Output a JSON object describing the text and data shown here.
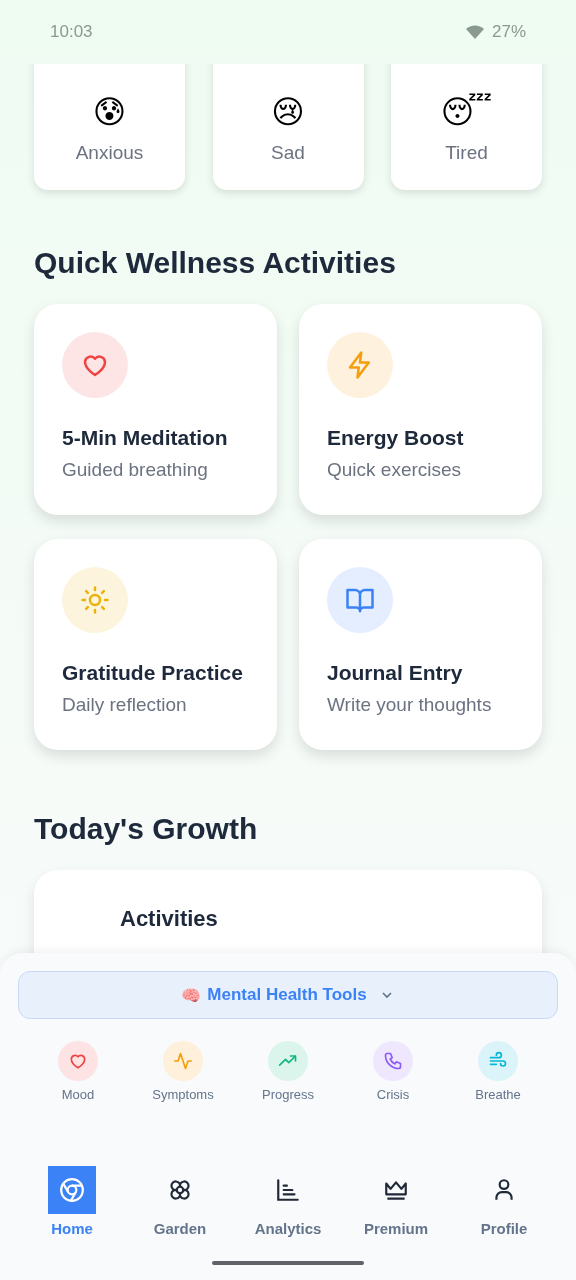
{
  "status_bar": {
    "time": "10:03",
    "battery": "27%"
  },
  "moods": [
    {
      "emoji": "😰",
      "label": "Anxious"
    },
    {
      "emoji": "😢",
      "label": "Sad"
    },
    {
      "emoji": "😴",
      "label": "Tired"
    }
  ],
  "activities": {
    "title": "Quick Wellness Activities",
    "items": [
      {
        "kind": "heart",
        "color": "#ef4444",
        "title": "5-Min Meditation",
        "subtitle": "Guided breathing"
      },
      {
        "kind": "bolt",
        "color": "#f59e0b",
        "title": "Energy Boost",
        "subtitle": "Quick exercises"
      },
      {
        "kind": "sun",
        "color": "#eab308",
        "title": "Gratitude Practice",
        "subtitle": "Daily reflection"
      },
      {
        "kind": "book",
        "color": "#3b82f6",
        "title": "Journal Entry",
        "subtitle": "Write your thoughts"
      }
    ]
  },
  "growth": {
    "title": "Today's Growth",
    "card_label": "Activities"
  },
  "tools": {
    "emoji": "🧠",
    "label": "Mental Health Tools",
    "expanded": false,
    "items": [
      {
        "kind": "heart",
        "color": "#ef4444",
        "label": "Mood"
      },
      {
        "kind": "pulse",
        "color": "#f59e0b",
        "label": "Symptoms"
      },
      {
        "kind": "trend",
        "color": "#10b981",
        "label": "Progress"
      },
      {
        "kind": "phone",
        "color": "#8b5cf6",
        "label": "Crisis"
      },
      {
        "kind": "wind",
        "color": "#06b6d4",
        "label": "Breathe"
      }
    ]
  },
  "nav": [
    {
      "kind": "home",
      "label": "Home",
      "selected": true
    },
    {
      "kind": "flower",
      "label": "Garden",
      "selected": false
    },
    {
      "kind": "chart",
      "label": "Analytics",
      "selected": false
    },
    {
      "kind": "crown",
      "label": "Premium",
      "selected": false
    },
    {
      "kind": "person",
      "label": "Profile",
      "selected": false
    }
  ]
}
